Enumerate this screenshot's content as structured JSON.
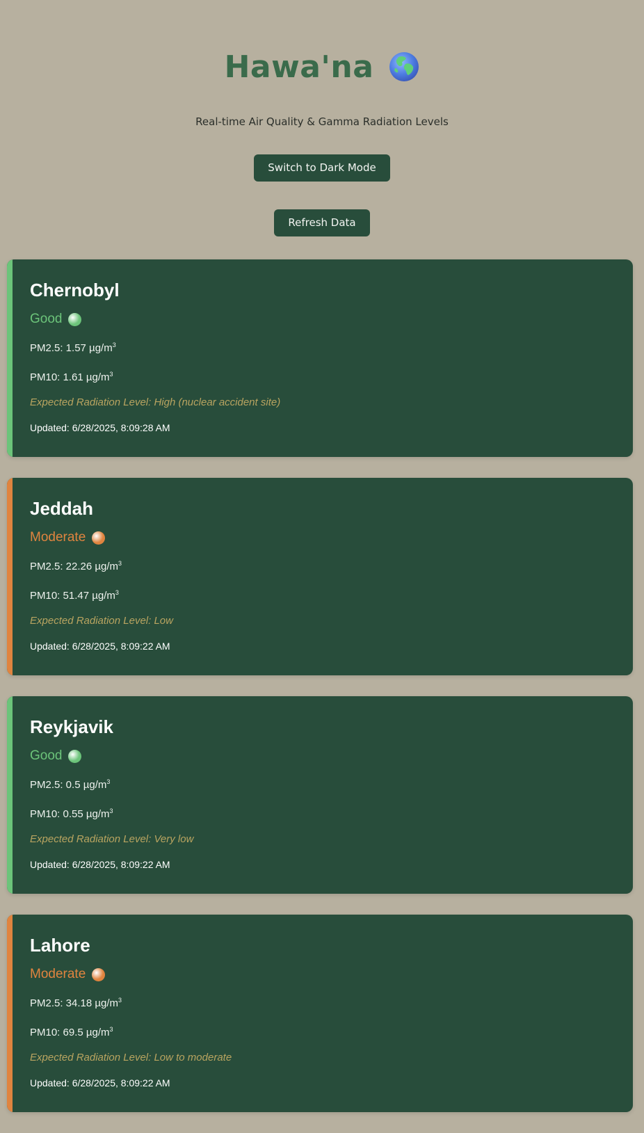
{
  "header": {
    "title": "Hawa'na",
    "title_icon": "globe-icon",
    "subtitle": "Real-time Air Quality & Gamma Radiation Levels"
  },
  "buttons": {
    "dark_mode_label": "Switch to Dark Mode",
    "refresh_label": "Refresh Data"
  },
  "colors": {
    "background": "#b7b09f",
    "card": "#284d3b",
    "good": "#6cc47a",
    "moderate": "#e0843f",
    "radiation_text": "#b9a460"
  },
  "cards": [
    {
      "city": "Chernobyl",
      "status": "Good",
      "status_level": "good",
      "pm25": "PM2.5: 1.57 µg/m",
      "pm10": "PM10: 1.61 µg/m",
      "unit_sup": "3",
      "radiation": "Expected Radiation Level: High (nuclear accident site)",
      "updated": "Updated: 6/28/2025, 8:09:28 AM"
    },
    {
      "city": "Jeddah",
      "status": "Moderate",
      "status_level": "moderate",
      "pm25": "PM2.5: 22.26 µg/m",
      "pm10": "PM10: 51.47 µg/m",
      "unit_sup": "3",
      "radiation": "Expected Radiation Level: Low",
      "updated": "Updated: 6/28/2025, 8:09:22 AM"
    },
    {
      "city": "Reykjavik",
      "status": "Good",
      "status_level": "good",
      "pm25": "PM2.5: 0.5 µg/m",
      "pm10": "PM10: 0.55 µg/m",
      "unit_sup": "3",
      "radiation": "Expected Radiation Level: Very low",
      "updated": "Updated: 6/28/2025, 8:09:22 AM"
    },
    {
      "city": "Lahore",
      "status": "Moderate",
      "status_level": "moderate",
      "pm25": "PM2.5: 34.18 µg/m",
      "pm10": "PM10: 69.5 µg/m",
      "unit_sup": "3",
      "radiation": "Expected Radiation Level: Low to moderate",
      "updated": "Updated: 6/28/2025, 8:09:22 AM"
    }
  ]
}
